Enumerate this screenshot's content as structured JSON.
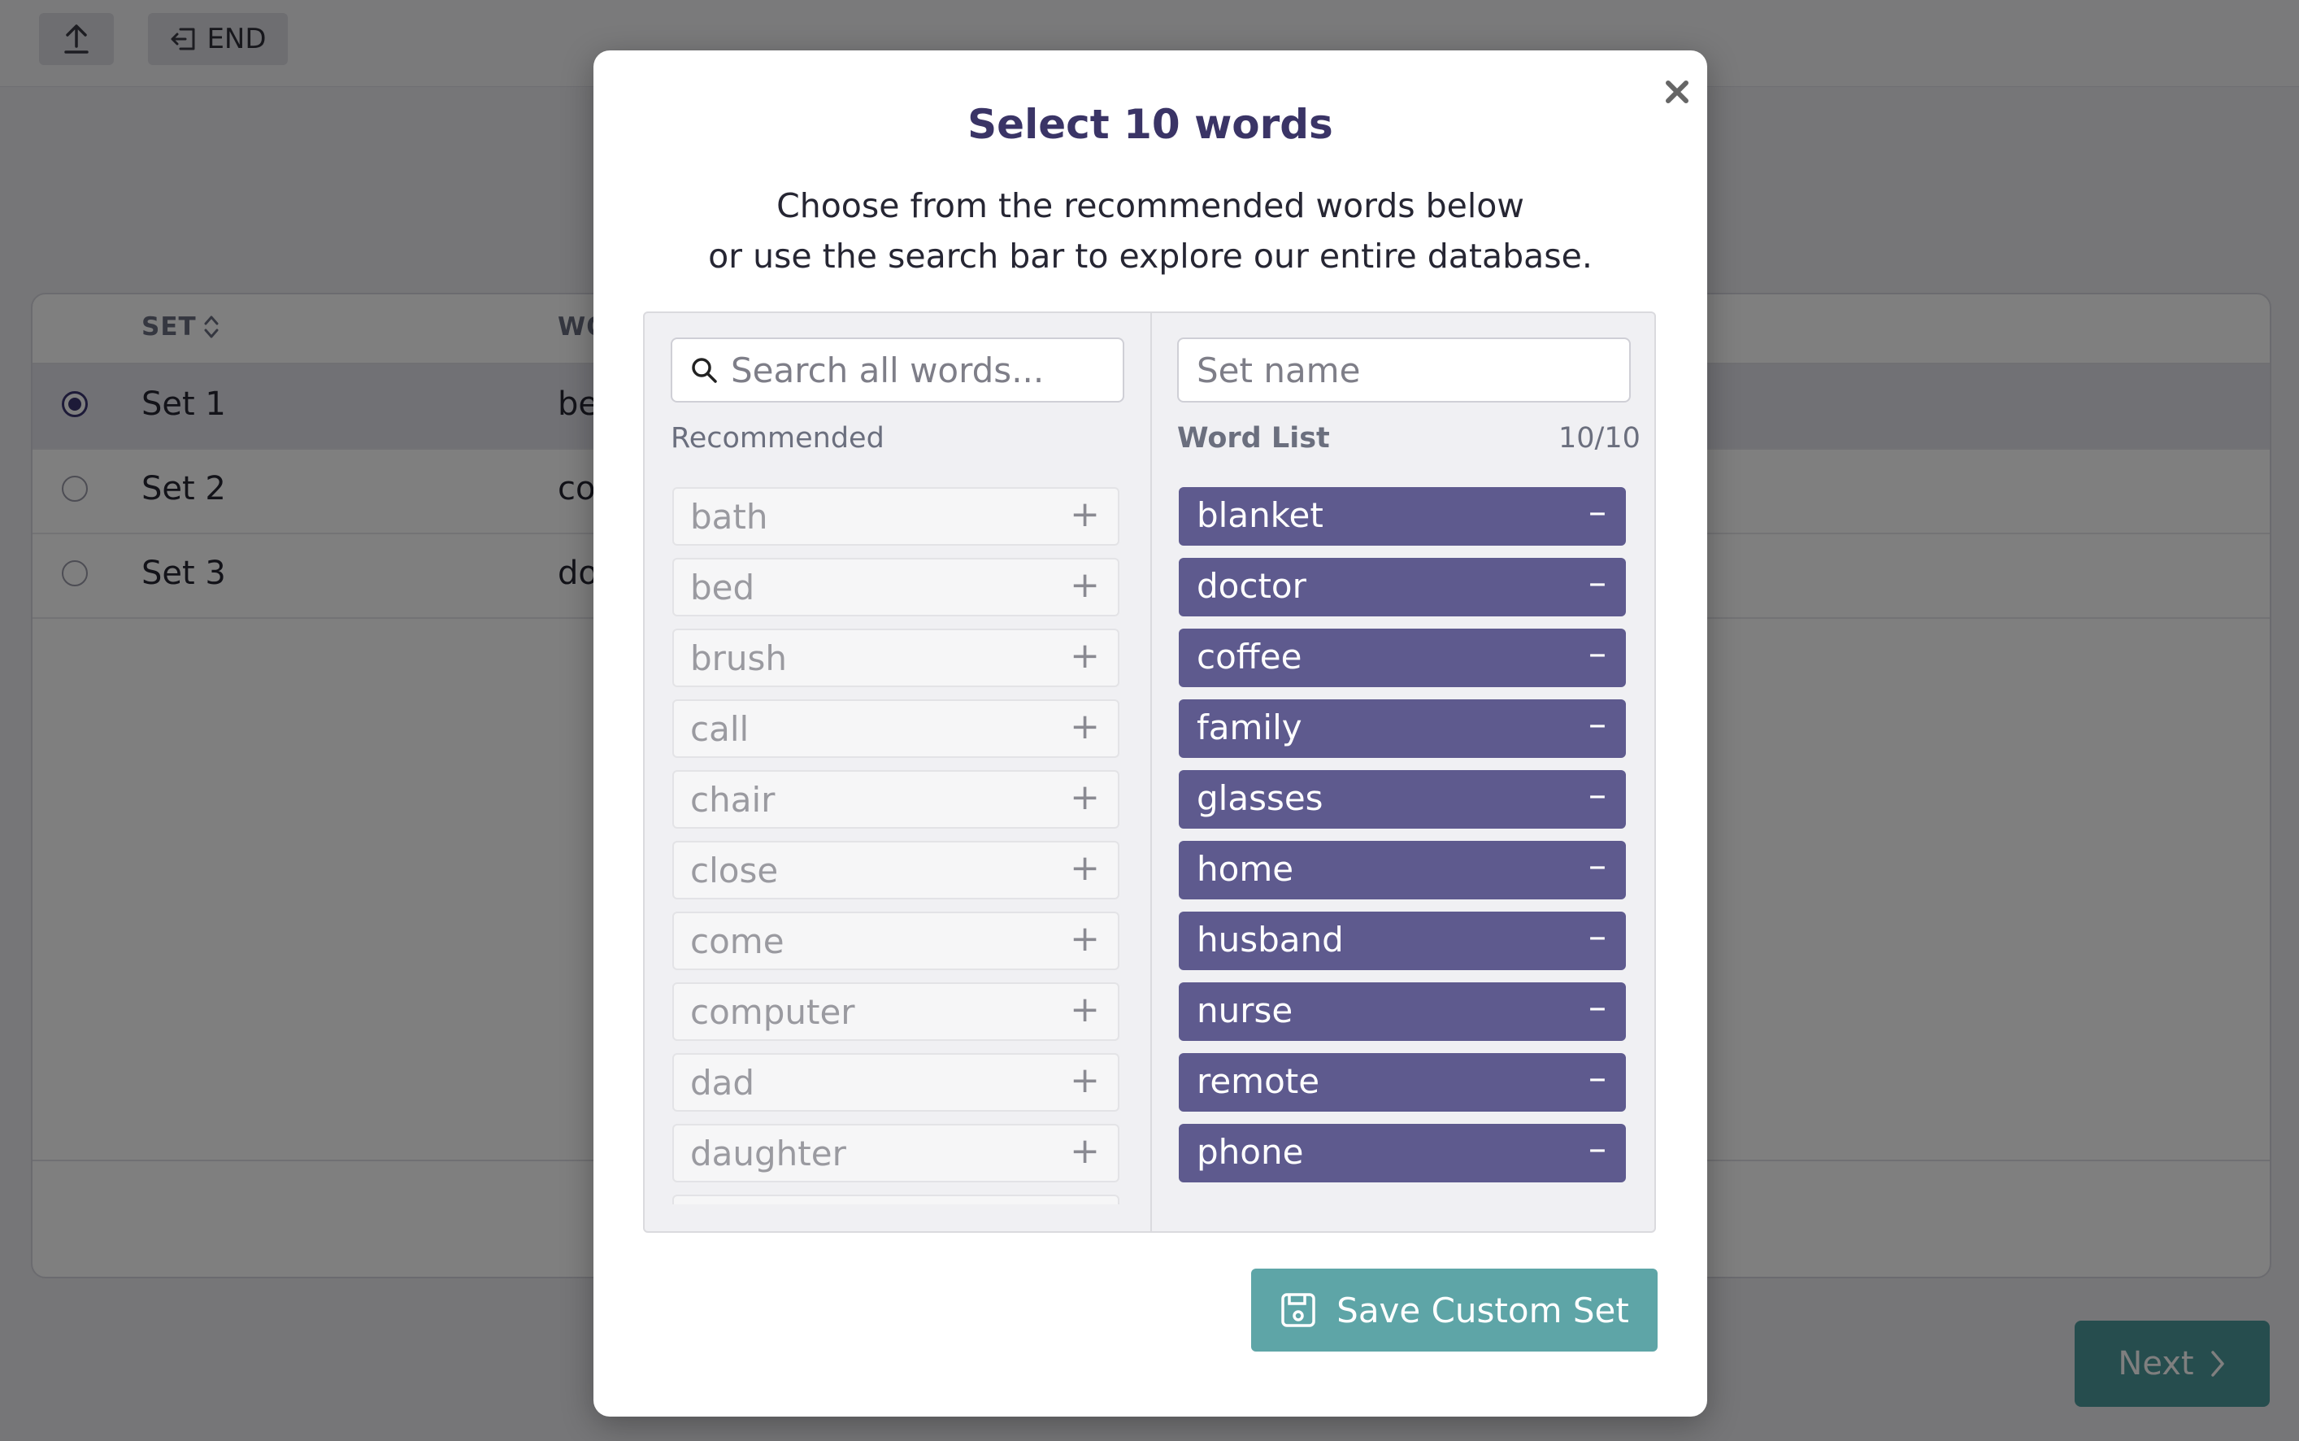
{
  "topbar": {
    "end_label": "END"
  },
  "table": {
    "col_set": "SET",
    "col_words": "WO",
    "rows": [
      {
        "set": "Set 1",
        "words": "be",
        "selected": true
      },
      {
        "set": "Set 2",
        "words": "co",
        "selected": false
      },
      {
        "set": "Set 3",
        "words": "do",
        "selected": false
      }
    ]
  },
  "next_label": "Next",
  "modal": {
    "title": "Select 10 words",
    "subtitle_line1": "Choose from the recommended words below",
    "subtitle_line2": "or use the search bar to explore our entire database.",
    "search_placeholder": "Search all words...",
    "setname_placeholder": "Set name",
    "recommended_label": "Recommended",
    "wordlist_label": "Word List",
    "wordlist_count": "10/10",
    "recommended": [
      "bath",
      "bed",
      "brush",
      "call",
      "chair",
      "close",
      "come",
      "computer",
      "dad",
      "daughter"
    ],
    "wordlist": [
      "blanket",
      "doctor",
      "coffee",
      "family",
      "glasses",
      "home",
      "husband",
      "nurse",
      "remote",
      "phone"
    ],
    "save_label": "Save Custom Set"
  },
  "colors": {
    "accent": "#5e5a8e",
    "teal": "#5ea5a7",
    "title": "#3a3466"
  }
}
